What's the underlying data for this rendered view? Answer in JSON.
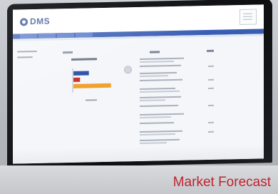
{
  "caption": {
    "text": "Market Forecast",
    "color": "#c0232f"
  },
  "app": {
    "logo_text": "DMS",
    "brand_color": "#2d4a8c",
    "nav_color": "#3a5db4"
  },
  "chart_data": {
    "type": "bar",
    "orientation": "horizontal",
    "series": [
      {
        "color": "#2f4fa8",
        "values": [
          0.35
        ]
      },
      {
        "color": "#c8322c",
        "values": [
          0.15
        ]
      },
      {
        "color": "#f0a12e",
        "values": [
          0.85
        ]
      }
    ]
  }
}
